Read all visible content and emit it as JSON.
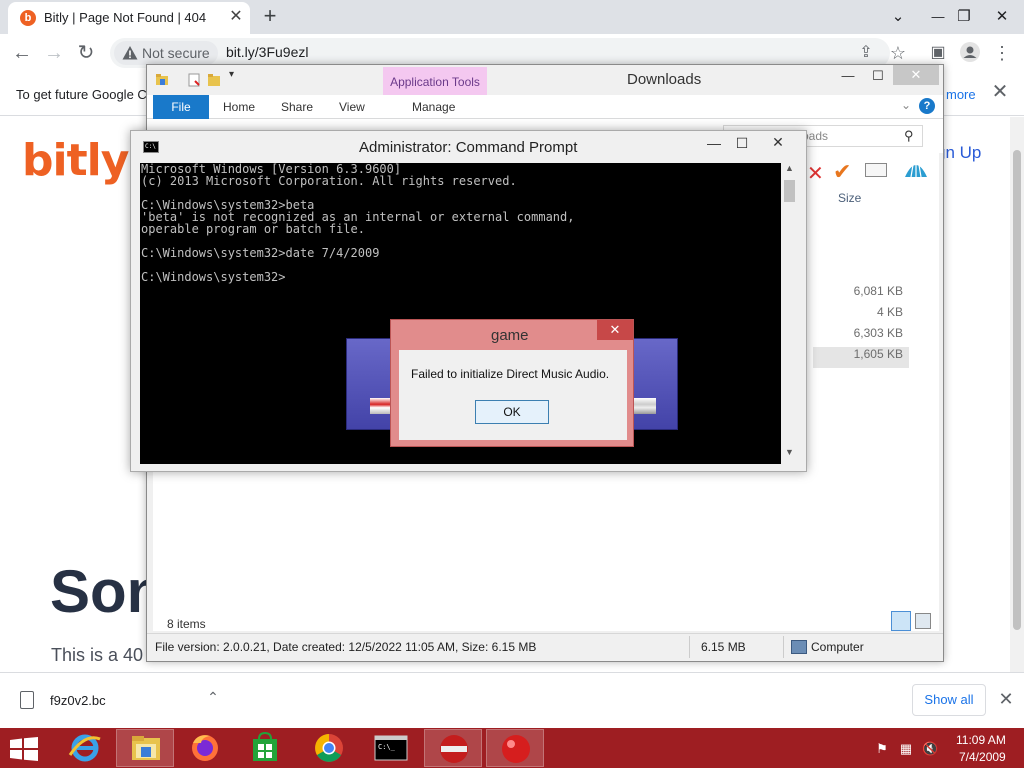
{
  "browser": {
    "tab_title": "Bitly | Page Not Found | 404",
    "tab_favicon": "b",
    "omnibox_security": "Not secure",
    "url": "bit.ly/3Fu9ezl",
    "infobar_text": "To get future Google C",
    "infobar_more": "more"
  },
  "page": {
    "logo": "bitly",
    "signup": "gn Up",
    "headline": "Son",
    "subtext": "This is a 40"
  },
  "downloads_bar": {
    "file_name": "f9z0v2.bc",
    "show_all": "Show all"
  },
  "explorer": {
    "title": "Downloads",
    "contextual_tab": "Application Tools",
    "ribbon_tabs": [
      "File",
      "Home",
      "Share",
      "View",
      "Manage"
    ],
    "search_placeholder": "oads",
    "size_header": "Size",
    "sizes": [
      "6,081 KB",
      "4 KB",
      "6,303 KB",
      "1,605 KB"
    ],
    "items_count": "8 items",
    "status_info": "File version: 2.0.0.21, Date created: 12/5/2022 11:05 AM, Size: 6.15 MB",
    "status_size": "6.15 MB",
    "status_location": "Computer"
  },
  "cmd": {
    "title": "Administrator: Command Prompt",
    "icon_text": "C:\\",
    "output": "Microsoft Windows [Version 6.3.9600]\n(c) 2013 Microsoft Corporation. All rights reserved.\n\nC:\\Windows\\system32>beta\n'beta' is not recognized as an internal or external command,\noperable program or batch file.\n\nC:\\Windows\\system32>date 7/4/2009\n\nC:\\Windows\\system32>"
  },
  "dialog": {
    "title": "game",
    "message": "Failed to initialize Direct Music Audio.",
    "ok": "OK"
  },
  "taskbar": {
    "time": "11:09 AM",
    "date": "7/4/2009",
    "apps": [
      "internet-explorer",
      "file-explorer",
      "firefox",
      "store",
      "chrome",
      "command-prompt",
      "app-red-bar",
      "app-red-ball"
    ]
  },
  "colors": {
    "bitly_orange": "#ee6123",
    "taskbar_red": "#9e1e22",
    "file_tab_blue": "#1979ca",
    "apptools_pink": "#f4c8f0"
  }
}
